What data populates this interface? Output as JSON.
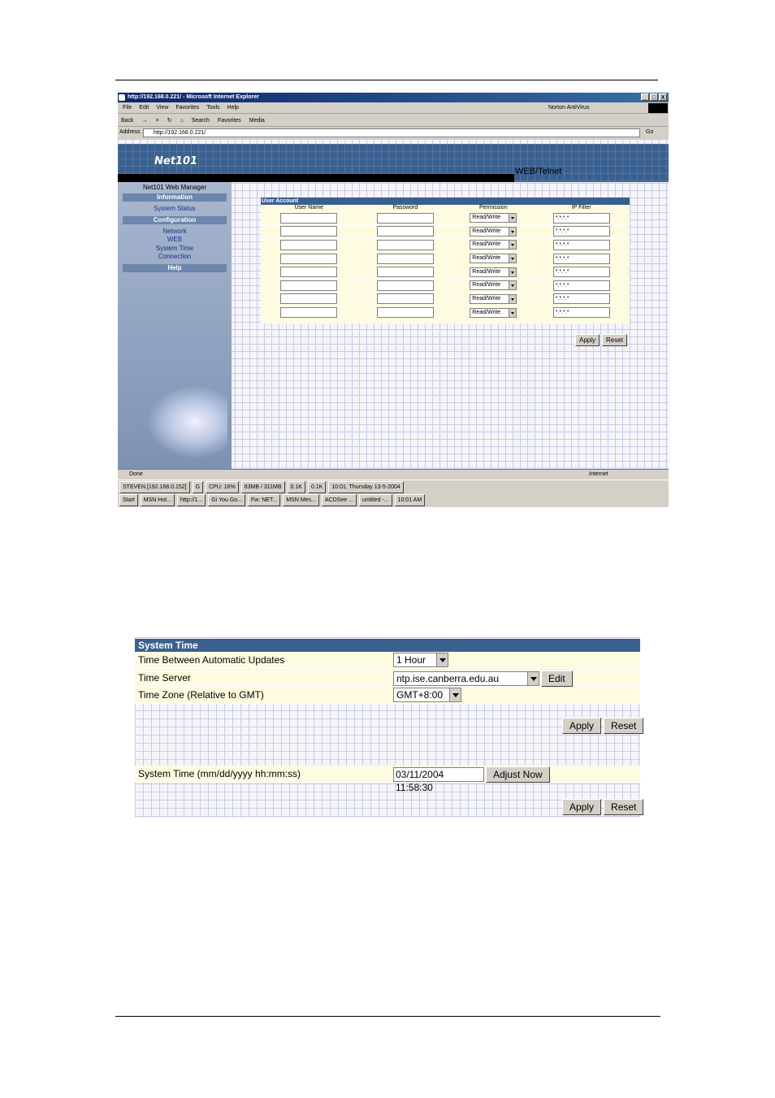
{
  "window": {
    "title": "http://192.168.0.221/ - Microsoft Internet Explorer",
    "controls": [
      "_",
      "□",
      "X"
    ],
    "menu": [
      "File",
      "Edit",
      "View",
      "Favorites",
      "Tools",
      "Help"
    ],
    "norton": "Norton AntiVirus",
    "toolbar": [
      "Back",
      "→",
      "×",
      "↻",
      "⌂",
      "Search",
      "Favorites",
      "Media"
    ],
    "address_label": "Address",
    "address_value": "http://192.168.0.221/",
    "go_label": "Go"
  },
  "page": {
    "logo": "Net101",
    "banner_label": "WEB/Telnet",
    "sidebar": {
      "title": "Net101 Web Manager",
      "information": "Information",
      "system_status": "System Status",
      "configuration": "Configuration",
      "network": "Network",
      "web": "WEB",
      "system_time": "System Time",
      "connection": "Connection",
      "help": "Help"
    },
    "user_account": {
      "title": "User Account",
      "col_user": "User Name",
      "col_pass": "Password",
      "col_perm": "Permission",
      "col_ip": "IP Filter",
      "rows": [
        {
          "perm": "Read/Write",
          "ip": "*.*.*.*"
        },
        {
          "perm": "Read/Write",
          "ip": "*.*.*.*"
        },
        {
          "perm": "Read/Write",
          "ip": "*.*.*.*"
        },
        {
          "perm": "Read/Write",
          "ip": "*.*.*.*"
        },
        {
          "perm": "Read/Write",
          "ip": "*.*.*.*"
        },
        {
          "perm": "Read/Write",
          "ip": "*.*.*.*"
        },
        {
          "perm": "Read/Write",
          "ip": "*.*.*.*"
        },
        {
          "perm": "Read/Write",
          "ip": "*.*.*.*"
        }
      ],
      "apply": "Apply",
      "reset": "Reset"
    }
  },
  "statusbar": {
    "left": "Done",
    "zone": "Internet"
  },
  "taskbar": {
    "row1": [
      "STEVEN [192.168.0.152]",
      "G",
      "CPU: 16%",
      "83MB / 311MB",
      "0.1K",
      "0.1K",
      "10:01, Thursday 13-5-2004"
    ],
    "row2": [
      "Start",
      "MSN Hot...",
      "http://1...",
      "Gi You Go...",
      "Fw: NET...",
      "MSN Mes...",
      "ACDSee ...",
      "untitled -...",
      "10:01 AM"
    ]
  },
  "system_time": {
    "title": "System Time",
    "update_label": "Time Between Automatic Updates",
    "update_value": "1 Hour",
    "server_label": "Time Server",
    "server_value": "ntp.ise.canberra.edu.au",
    "edit": "Edit",
    "zone_label": "Time Zone (Relative to GMT)",
    "zone_value": "GMT+8:00",
    "apply": "Apply",
    "reset": "Reset",
    "systime_label": "System Time (mm/dd/yyyy hh:mm:ss)",
    "systime_value": "03/11/2004 11:58:30",
    "adjust": "Adjust Now"
  }
}
